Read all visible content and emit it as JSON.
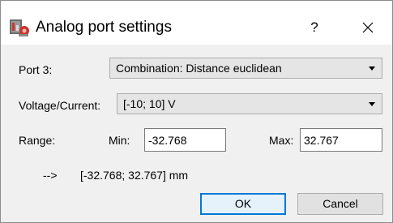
{
  "window": {
    "title": "Analog port settings",
    "help_label": "?"
  },
  "port": {
    "label": "Port 3:",
    "selected": "Combination: Distance euclidean"
  },
  "voltage": {
    "label": "Voltage/Current:",
    "selected": "[-10; 10] V"
  },
  "range": {
    "label": "Range:",
    "min_label": "Min:",
    "min_value": "-32.768",
    "max_label": "Max:",
    "max_value": "32.767"
  },
  "result": {
    "arrow": "-->",
    "text": "[-32.768; 32.767] mm"
  },
  "buttons": {
    "ok": "OK",
    "cancel": "Cancel"
  },
  "colors": {
    "accent": "#0078d7",
    "dialog_bg": "#f0f0f0",
    "icon_red": "#c8342c"
  }
}
